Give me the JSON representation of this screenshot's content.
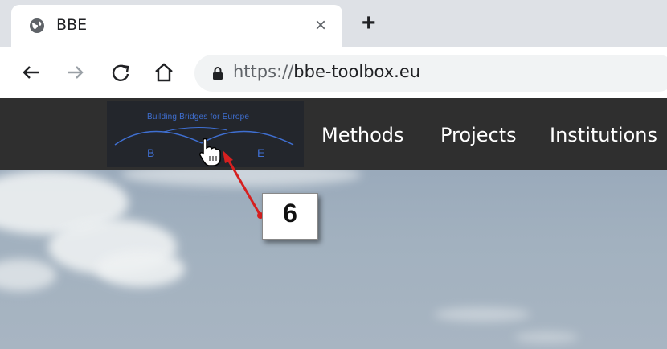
{
  "browser": {
    "tab_title": "BBE",
    "close_glyph": "×",
    "newtab_glyph": "+",
    "url_scheme": "https://",
    "url_host": "bbe-toolbox.eu"
  },
  "site": {
    "logo_text": "Building Bridges for Europe",
    "logo_b": "B",
    "logo_e": "E",
    "menu": [
      "Methods",
      "Projects",
      "Institutions"
    ]
  },
  "annotation": {
    "step_number": "6",
    "arrow_color": "#d62020"
  }
}
